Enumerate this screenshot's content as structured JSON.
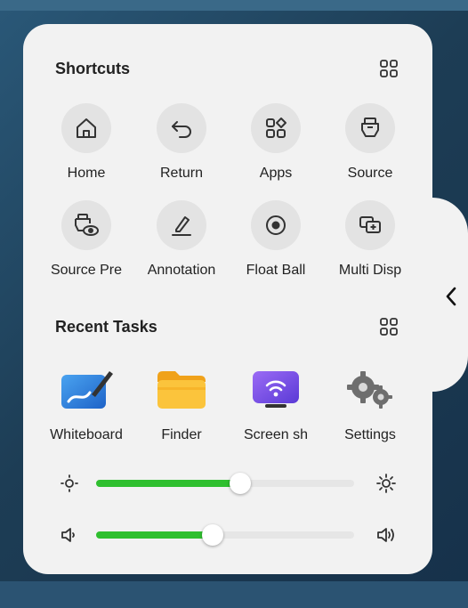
{
  "colors": {
    "panel": "#f2f2f2",
    "accent_green": "#2fbf2f",
    "icon_circle": "#e3e3e3"
  },
  "shortcuts": {
    "title": "Shortcuts",
    "items": [
      {
        "label": "Home",
        "icon": "home-icon"
      },
      {
        "label": "Return",
        "icon": "return-icon"
      },
      {
        "label": "Apps",
        "icon": "apps-icon"
      },
      {
        "label": "Source",
        "icon": "source-icon"
      },
      {
        "label": "Source Pre",
        "icon": "source-preview-icon"
      },
      {
        "label": "Annotation",
        "icon": "annotation-icon"
      },
      {
        "label": "Float Ball",
        "icon": "float-ball-icon"
      },
      {
        "label": "Multi Disp",
        "icon": "multi-display-icon"
      }
    ]
  },
  "recent_tasks": {
    "title": "Recent Tasks",
    "items": [
      {
        "label": "Whiteboard",
        "icon": "whiteboard-app-icon"
      },
      {
        "label": "Finder",
        "icon": "finder-folder-icon"
      },
      {
        "label": "Screen sh",
        "icon": "screen-share-icon"
      },
      {
        "label": "Settings",
        "icon": "settings-gears-icon"
      }
    ]
  },
  "sliders": {
    "brightness": {
      "value_percent": 56,
      "low_icon": "brightness-low-icon",
      "high_icon": "brightness-high-icon"
    },
    "volume": {
      "value_percent": 45,
      "low_icon": "volume-low-icon",
      "high_icon": "volume-high-icon"
    }
  }
}
